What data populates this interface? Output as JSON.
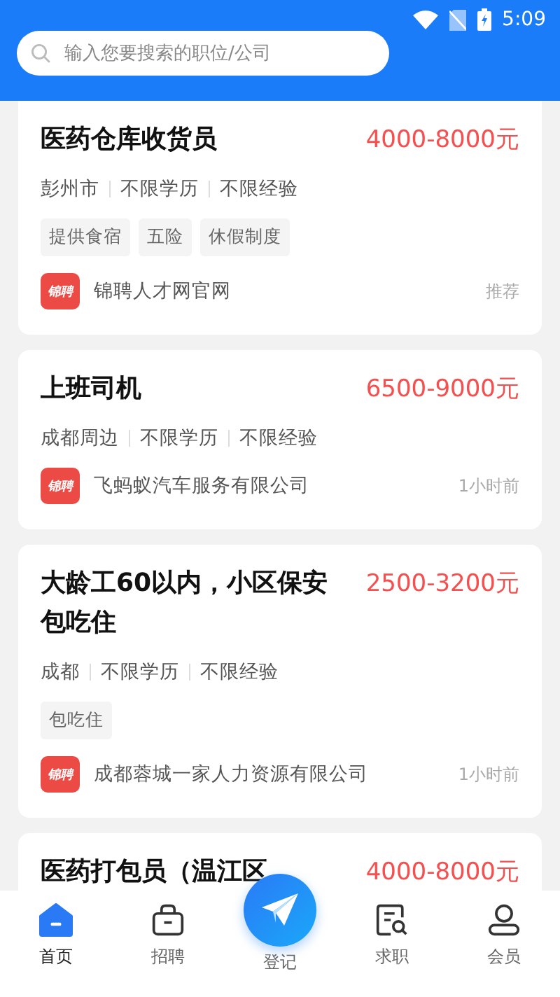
{
  "status_bar": {
    "time": "5:09"
  },
  "search": {
    "placeholder": "输入您要搜索的职位/公司"
  },
  "jobs": [
    {
      "title": "医药仓库收货员",
      "salary": "4000-8000元",
      "meta": [
        "彭州市",
        "不限学历",
        "不限经验"
      ],
      "tags": [
        "提供食宿",
        "五险",
        "休假制度"
      ],
      "logo_text": "锦聘",
      "company": "锦聘人才网官网",
      "time": "推荐"
    },
    {
      "title": "上班司机",
      "salary": "6500-9000元",
      "meta": [
        "成都周边",
        "不限学历",
        "不限经验"
      ],
      "logo_text": "锦聘",
      "company": "飞蚂蚁汽车服务有限公司",
      "time": "1小时前"
    },
    {
      "title": "大龄工60以内，小区保安包吃住",
      "salary": "2500-3200元",
      "meta": [
        "成都",
        "不限学历",
        "不限经验"
      ],
      "tags": [
        "包吃住"
      ],
      "logo_text": "锦聘",
      "company": "成都蓉城一家人力资源有限公司",
      "time": "1小时前"
    },
    {
      "title": "医药打包员（温江区",
      "salary": "4000-8000元"
    }
  ],
  "nav": [
    {
      "label": "首页",
      "kind": "home",
      "selected": true
    },
    {
      "label": "招聘",
      "kind": "bag",
      "selected": false
    },
    {
      "label": "登记",
      "kind": "plane",
      "selected": false
    },
    {
      "label": "求职",
      "kind": "resume",
      "selected": false
    },
    {
      "label": "会员",
      "kind": "user",
      "selected": false
    }
  ]
}
